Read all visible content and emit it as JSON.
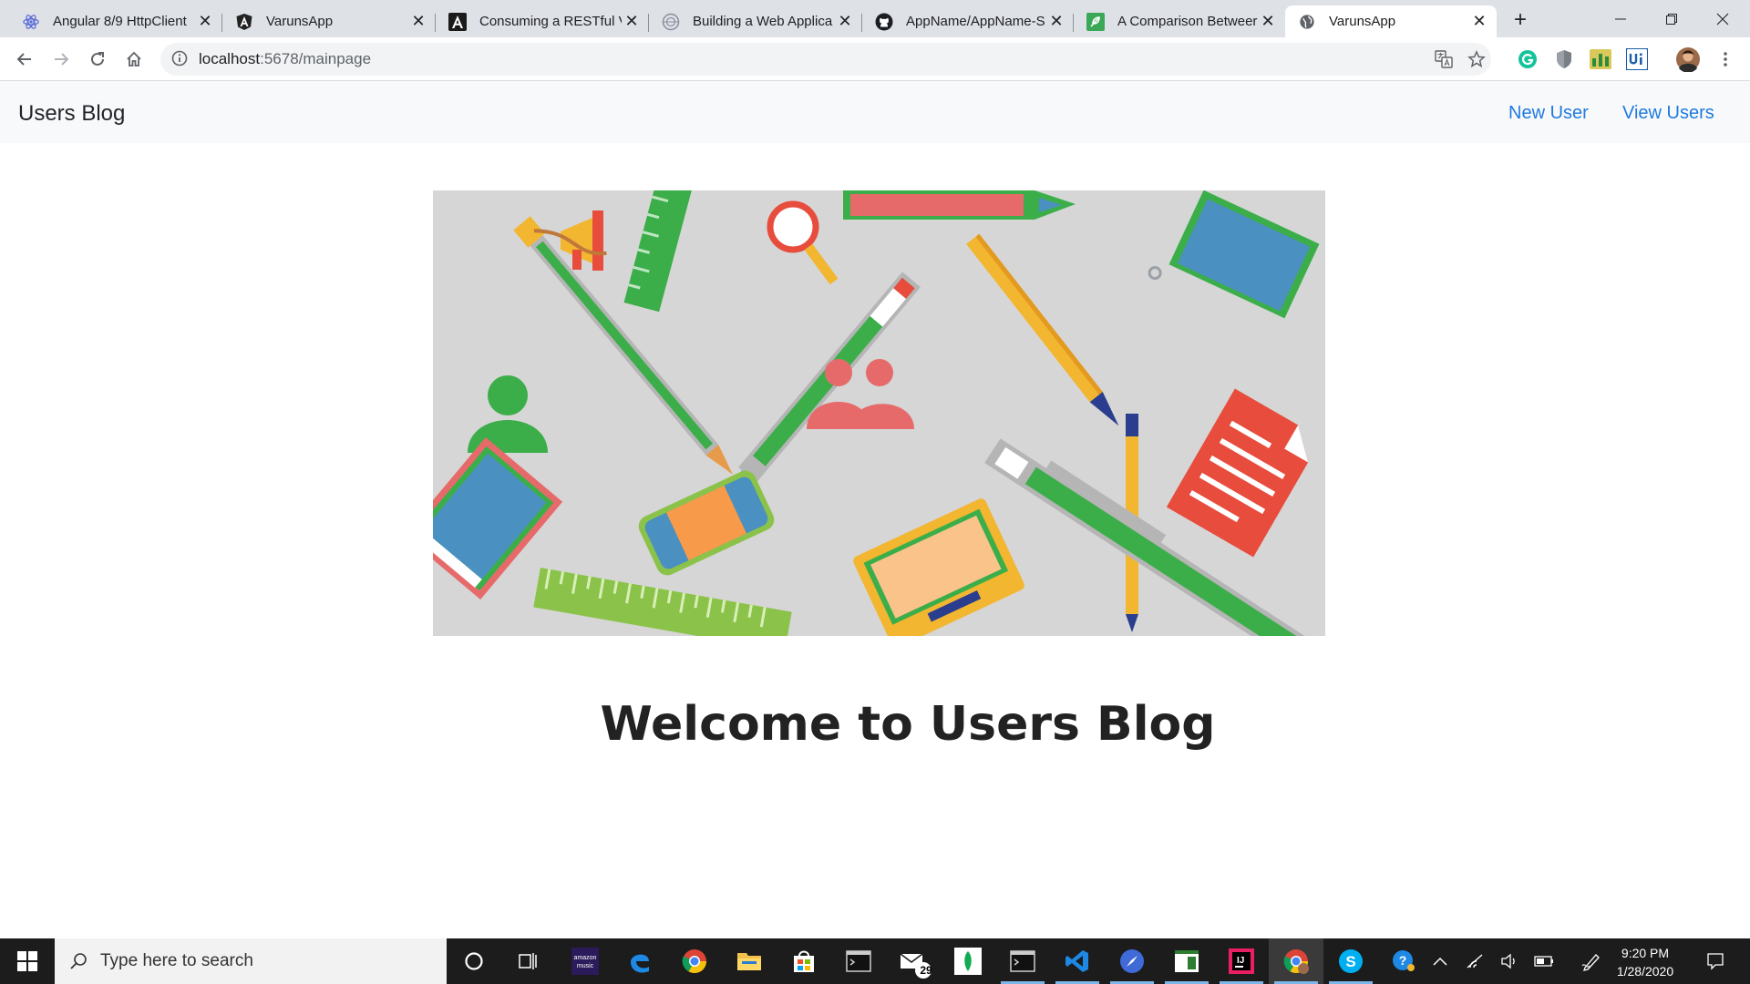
{
  "browser": {
    "tabs": [
      {
        "title": "Angular 8/9 HttpClient",
        "icon": "react-icon",
        "active": false
      },
      {
        "title": "VarunsApp",
        "icon": "angular-icon",
        "active": false
      },
      {
        "title": "Consuming a RESTful V",
        "icon": "a-logo-icon",
        "active": false
      },
      {
        "title": "Building a Web Applica",
        "icon": "globe-site-icon",
        "active": false
      },
      {
        "title": "AppName/AppName-S",
        "icon": "github-icon",
        "active": false
      },
      {
        "title": "A Comparison Betweer",
        "icon": "feather-icon",
        "active": false
      },
      {
        "title": "VarunsApp",
        "icon": "globe-icon",
        "active": true
      }
    ],
    "address": {
      "host": "localhost",
      "path": ":5678/mainpage"
    }
  },
  "app": {
    "brand": "Users Blog",
    "nav": {
      "new_user": "New User",
      "view_users": "View Users"
    },
    "welcome": "Welcome to Users Blog"
  },
  "taskbar": {
    "search_placeholder": "Type here to search",
    "mail_badge": "29",
    "time": "9:20 PM",
    "date": "1/28/2020",
    "amazon_label_1": "amazon",
    "amazon_label_2": "music"
  },
  "colors": {
    "link": "#1f7ae0",
    "navbar_bg": "#f8f9fa",
    "hero_bg": "#d6d6d6",
    "taskbar_bg": "#1c1c1c"
  }
}
